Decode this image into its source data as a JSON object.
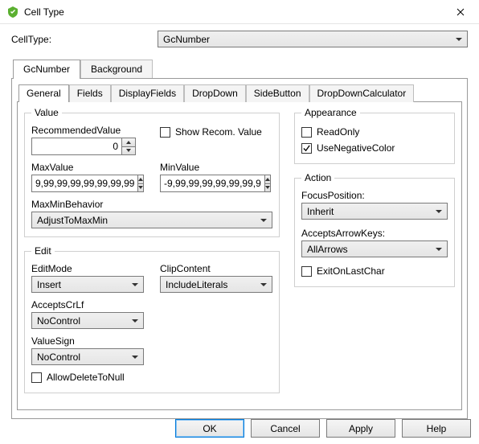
{
  "window": {
    "title": "Cell Type"
  },
  "celltype_label": "CellType:",
  "celltype_value": "GcNumber",
  "outer_tabs": [
    {
      "label": "GcNumber",
      "active": true
    },
    {
      "label": "Background",
      "active": false
    }
  ],
  "subtabs": [
    {
      "label": "General",
      "active": true
    },
    {
      "label": "Fields"
    },
    {
      "label": "DisplayFields"
    },
    {
      "label": "DropDown"
    },
    {
      "label": "SideButton"
    },
    {
      "label": "DropDownCalculator"
    }
  ],
  "groups": {
    "value": {
      "legend": "Value",
      "recommended_label": "RecommendedValue",
      "recommended_value": "0",
      "show_recom_label": "Show Recom. Value",
      "show_recom_checked": false,
      "max_label": "MaxValue",
      "max_value": "9,99,99,99,99,99,99,99",
      "min_label": "MinValue",
      "min_value": "-9,99,99,99,99,99,99,9",
      "maxmin_label": "MaxMinBehavior",
      "maxmin_value": "AdjustToMaxMin"
    },
    "edit": {
      "legend": "Edit",
      "editmode_label": "EditMode",
      "editmode_value": "Insert",
      "clip_label": "ClipContent",
      "clip_value": "IncludeLiterals",
      "acceptscrlf_label": "AcceptsCrLf",
      "acceptscrlf_value": "NoControl",
      "valuesign_label": "ValueSign",
      "valuesign_value": "NoControl",
      "allowdelete_label": "AllowDeleteToNull",
      "allowdelete_checked": false
    },
    "appearance": {
      "legend": "Appearance",
      "readonly_label": "ReadOnly",
      "readonly_checked": false,
      "usenegative_label": "UseNegativeColor",
      "usenegative_checked": true
    },
    "action": {
      "legend": "Action",
      "focus_label": "FocusPosition:",
      "focus_value": "Inherit",
      "arrows_label": "AcceptsArrowKeys:",
      "arrows_value": "AllArrows",
      "exit_label": "ExitOnLastChar",
      "exit_checked": false
    }
  },
  "buttons": {
    "ok": "OK",
    "cancel": "Cancel",
    "apply": "Apply",
    "help": "Help"
  }
}
